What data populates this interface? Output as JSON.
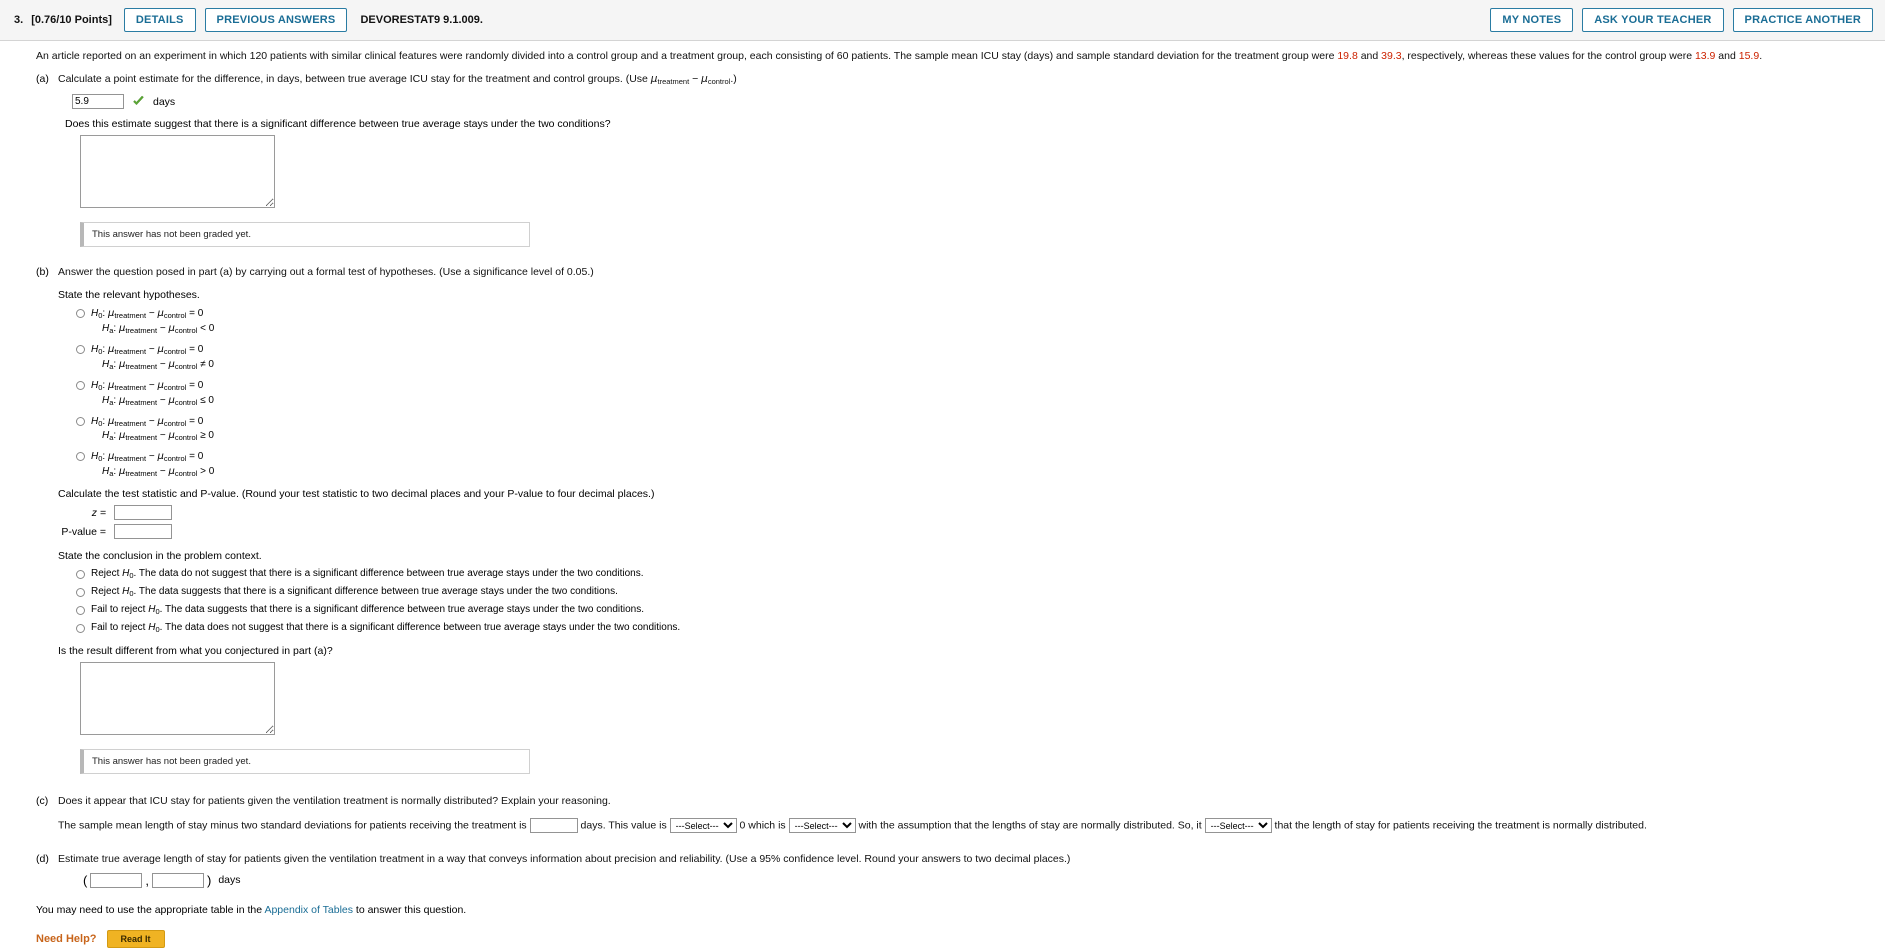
{
  "header": {
    "question_number": "3.",
    "points": "[0.76/10 Points]",
    "details_label": "DETAILS",
    "previous_answers_label": "PREVIOUS ANSWERS",
    "textbook_ref": "DEVORESTAT9 9.1.009.",
    "my_notes_label": "MY NOTES",
    "ask_teacher_label": "ASK YOUR TEACHER",
    "practice_another_label": "PRACTICE ANOTHER"
  },
  "statement": {
    "t1": "An article reported on an experiment in which 120 patients with similar clinical features were randomly divided into a control group and a treatment group, each consisting of 60 patients. The sample mean ICU stay (days) and sample standard deviation for the treatment group were ",
    "v1": "19.8",
    "t2": " and ",
    "v2": "39.3",
    "t3": ", respectively, whereas these values for the control group were ",
    "v3": "13.9",
    "t4": " and ",
    "v4": "15.9",
    "t5": "."
  },
  "partA": {
    "label": "(a)",
    "prompt_pre": "Calculate a point estimate for the difference, in days, between true average ICU stay for the treatment and control groups. (Use ",
    "mu1": "μ",
    "sub1": "treatment",
    "minus": " − ",
    "mu2": "μ",
    "sub2": "control",
    "prompt_post": ".)",
    "answer_value": "5.9",
    "unit": "days",
    "check_icon": "green-check-icon",
    "followup": "Does this estimate suggest that there is a significant difference between true average stays under the two conditions?",
    "textarea_value": "",
    "graded_note": "This answer has not been graded yet."
  },
  "partB": {
    "label": "(b)",
    "prompt": "Answer the question posed in part (a) by carrying out a formal test of hypotheses. (Use a significance level of 0.05.)",
    "hyp_heading": "State the relevant hypotheses.",
    "hypotheses": [
      {
        "h0_sign": "=",
        "ha_sign": "<"
      },
      {
        "h0_sign": "=",
        "ha_sign": "≠"
      },
      {
        "h0_sign": "=",
        "ha_sign": "≤"
      },
      {
        "h0_sign": "=",
        "ha_sign": "≥"
      },
      {
        "h0_sign": "=",
        "ha_sign": ">"
      }
    ],
    "hyp_h0_name": "H",
    "hyp_h0_sub": "0",
    "hyp_ha_name": "H",
    "hyp_ha_sub": "a",
    "hyp_mu1": "μ",
    "hyp_sub1": "treatment",
    "hyp_minus": "−",
    "hyp_mu2": "μ",
    "hyp_sub2": "control",
    "hyp_rhs": "0",
    "calc_prompt": "Calculate the test statistic and P-value. (Round your test statistic to two decimal places and your P-value to four decimal places.)",
    "z_label": "z =",
    "z_value": "",
    "p_label": "P-value =",
    "p_value": "",
    "conclusion_heading": "State the conclusion in the problem context.",
    "conclusions": [
      "Reject H0. The data do not suggest that there is a significant difference between true average stays under the two conditions.",
      "Reject H0. The data suggests that there is a significant difference between true average stays under the two conditions.",
      "Fail to reject H0. The data suggests that there is a significant difference between true average stays under the two conditions.",
      "Fail to reject H0. The data does not suggest that there is a significant difference between true average stays under the two conditions."
    ],
    "conclusion_parts": [
      {
        "pre": "Reject ",
        "h": "H",
        "hsub": "0",
        "post": ". The data do not suggest that there is a significant difference between true average stays under the two conditions."
      },
      {
        "pre": "Reject ",
        "h": "H",
        "hsub": "0",
        "post": ". The data suggests that there is a significant difference between true average stays under the two conditions."
      },
      {
        "pre": "Fail to reject ",
        "h": "H",
        "hsub": "0",
        "post": ". The data suggests that there is a significant difference between true average stays under the two conditions."
      },
      {
        "pre": "Fail to reject ",
        "h": "H",
        "hsub": "0",
        "post": ". The data does not suggest that there is a significant difference between true average stays under the two conditions."
      }
    ],
    "followup": "Is the result different from what you conjectured in part (a)?",
    "textarea_value": "",
    "graded_note": "This answer has not been graded yet."
  },
  "partC": {
    "label": "(c)",
    "prompt": "Does it appear that ICU stay for patients given the ventilation treatment is normally distributed? Explain your reasoning.",
    "s1": "The sample mean length of stay minus two standard deviations for patients receiving the treatment is",
    "input1_value": "",
    "s2": "days. This value is",
    "select1_value": "---Select---",
    "s3": "0 which is",
    "select2_value": "---Select---",
    "s4": "with the assumption that the lengths of stay are normally distributed. So, it",
    "select3_value": "---Select---",
    "s5": "that the length of stay for patients receiving the treatment is normally distributed."
  },
  "partD": {
    "label": "(d)",
    "prompt": "Estimate true average length of stay for patients given the ventilation treatment in a way that conveys information about precision and reliability. (Use a 95% confidence level. Round your answers to two decimal places.)",
    "open_paren": "(",
    "lower_value": "",
    "comma": ",",
    "upper_value": "",
    "close_paren": ")",
    "unit": "days"
  },
  "footer": {
    "pre": "You may need to use the appropriate table in the ",
    "link": "Appendix of Tables",
    "post": " to answer this question.",
    "need_help": "Need Help?",
    "read_it": "Read It"
  },
  "colors": {
    "accent_blue": "#1a6d95",
    "number_red": "#cc2200",
    "help_orange": "#c8651b",
    "read_it_yellow": "#f0b323",
    "check_green": "#5aa832"
  }
}
